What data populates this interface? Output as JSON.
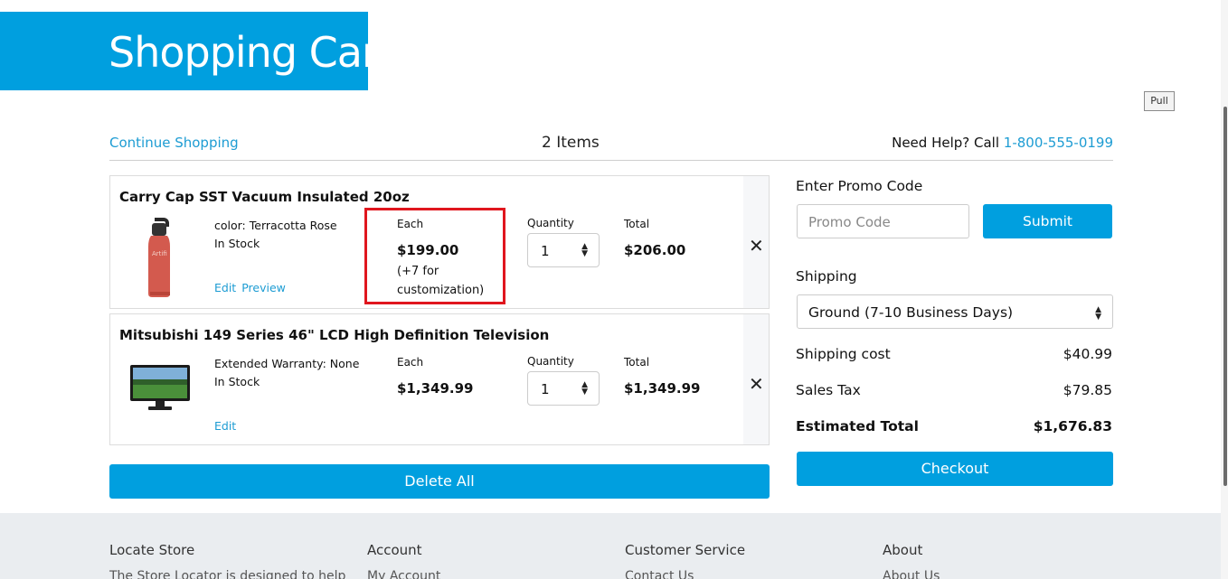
{
  "header": {
    "title": "Shopping Cart",
    "pull_label": "Pull"
  },
  "topbar": {
    "continue_label": "Continue Shopping",
    "item_count": "2 Items",
    "help_text": "Need Help? Call ",
    "help_phone": "1-800-555-0199"
  },
  "cart": {
    "labels": {
      "each": "Each",
      "quantity": "Quantity",
      "total": "Total",
      "remove_symbol": "✕"
    },
    "items": [
      {
        "title": "Carry Cap SST Vacuum Insulated 20oz",
        "option": "color: Terracotta Rose",
        "stock": "In Stock",
        "edit_label": "Edit",
        "preview_label": "Preview",
        "each_price": "$199.00",
        "custom_note_1": "(+7 for",
        "custom_note_2": "customization)",
        "quantity": "1",
        "total": "$206.00",
        "image_text": "Artifi"
      },
      {
        "title": "Mitsubishi 149 Series 46\" LCD High Definition Television",
        "option": "Extended Warranty: None",
        "stock": "In Stock",
        "edit_label": "Edit",
        "each_price": "$1,349.99",
        "quantity": "1",
        "total": "$1,349.99"
      }
    ],
    "delete_all_label": "Delete All"
  },
  "summary": {
    "promo_label": "Enter Promo Code",
    "promo_placeholder": "Promo Code",
    "submit_label": "Submit",
    "shipping_label": "Shipping",
    "shipping_option": "Ground (7-10 Business Days)",
    "shipping_cost_label": "Shipping cost",
    "shipping_cost": "$40.99",
    "sales_tax_label": "Sales Tax",
    "sales_tax": "$79.85",
    "estimated_total_label": "Estimated Total",
    "estimated_total": "$1,676.83",
    "checkout_label": "Checkout"
  },
  "footer": {
    "columns": [
      {
        "heading": "Locate Store",
        "sub": "The Store Locator is designed to help"
      },
      {
        "heading": "Account",
        "sub": "My Account"
      },
      {
        "heading": "Customer Service",
        "sub": "Contact Us"
      },
      {
        "heading": "About",
        "sub": "About Us"
      }
    ]
  },
  "colors": {
    "brand": "#009fdf",
    "link": "#1d9cd3",
    "highlight": "#e0161e"
  },
  "icons": {
    "remove": "close-icon",
    "select": "select-arrows-icon"
  }
}
